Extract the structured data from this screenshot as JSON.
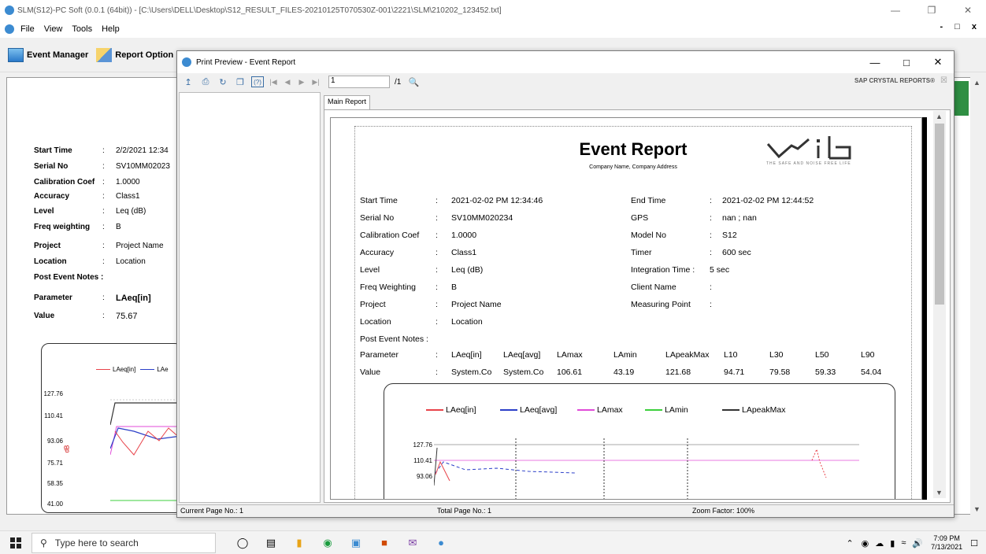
{
  "app": {
    "title": "SLM(S12)-PC Soft (0.0.1 (64bit)) - [C:\\Users\\DELL\\Desktop\\S12_RESULT_FILES-20210125T070530Z-001\\2221\\SLM\\210202_123452.txt]",
    "menu": [
      "File",
      "View",
      "Tools",
      "Help"
    ],
    "toolbar": {
      "event_manager": "Event Manager",
      "report_option": "Report Option"
    }
  },
  "background": {
    "fields": [
      {
        "k": "Start Time",
        "v": "2/2/2021 12:34"
      },
      {
        "k": "Serial No",
        "v": "SV10MM02023"
      },
      {
        "k": "Calibration Coef",
        "v": "1.0000"
      },
      {
        "k": "Accuracy",
        "v": "Class1"
      },
      {
        "k": "Level",
        "v": "Leq (dB)"
      },
      {
        "k": "Freq weighting",
        "v": "B"
      },
      {
        "k": "Project",
        "v": "Project Name"
      },
      {
        "k": "Location",
        "v": "Location"
      },
      {
        "k": "Post Event Notes :",
        "v": ""
      },
      {
        "k": "Parameter",
        "v": "LAeq[in]"
      },
      {
        "k": "Value",
        "v": "75.67"
      }
    ],
    "legend": [
      "LAeq[in]",
      "LAe"
    ],
    "ylabel": "dB",
    "yticks": [
      "127.76",
      "110.41",
      "93.06",
      "75.71",
      "58.35",
      "41.00"
    ]
  },
  "preview": {
    "title": "Print Preview - Event Report",
    "page_input": "1",
    "page_count": "/1",
    "brand": "SAP CRYSTAL REPORTS®",
    "tab": "Main Report",
    "status": {
      "current": "Current Page No.: 1",
      "total": "Total Page No.: 1",
      "zoom": "Zoom Factor: 100%"
    }
  },
  "report": {
    "title": "Event Report",
    "subtitle": "Company Name, Company Address",
    "logo_text": "ViB",
    "logo_tag": "THE SAFE AND NOISE FREE LIFE",
    "left_fields": [
      {
        "k": "Start Time",
        "v": "2021-02-02 PM 12:34:46"
      },
      {
        "k": "Serial No",
        "v": "SV10MM020234"
      },
      {
        "k": "Calibration Coef",
        "v": "1.0000"
      },
      {
        "k": "Accuracy",
        "v": "Class1"
      },
      {
        "k": "Level",
        "v": "Leq (dB)"
      },
      {
        "k": "Freq Weighting",
        "v": "B"
      },
      {
        "k": "Project",
        "v": "Project Name"
      },
      {
        "k": "Location",
        "v": "Location"
      },
      {
        "k": "Post Event Notes :",
        "v": ""
      }
    ],
    "right_fields": [
      {
        "k": "End Time",
        "v": "2021-02-02 PM 12:44:52"
      },
      {
        "k": "GPS",
        "v": "nan ; nan"
      },
      {
        "k": "Model No",
        "v": "S12"
      },
      {
        "k": "Timer",
        "v": "600 sec"
      },
      {
        "k": "Integration Time :",
        "v": "5 sec"
      },
      {
        "k": "Client Name",
        "v": ""
      },
      {
        "k": "Measuring Point",
        "v": ""
      }
    ],
    "param_header": "Parameter",
    "value_header": "Value",
    "params": [
      "LAeq[in]",
      "LAeq[avg]",
      "LAmax",
      "LAmin",
      "LApeakMax",
      "L10",
      "L30",
      "L50",
      "L90"
    ],
    "values": [
      "System.Co",
      "System.Co",
      "106.61",
      "43.19",
      "121.68",
      "94.71",
      "79.58",
      "59.33",
      "54.04"
    ],
    "legend": [
      {
        "name": "LAeq[in]",
        "color": "#e8434a"
      },
      {
        "name": "LAeq[avg]",
        "color": "#2b3fc8"
      },
      {
        "name": "LAmax",
        "color": "#e04bd8"
      },
      {
        "name": "LAmin",
        "color": "#3ccf3c"
      },
      {
        "name": "LApeakMax",
        "color": "#333333"
      }
    ],
    "yticks": [
      "127.76",
      "110.41",
      "93.06"
    ]
  },
  "taskbar": {
    "search": "Type here to search",
    "time": "7:09 PM",
    "date": "7/13/2021"
  }
}
